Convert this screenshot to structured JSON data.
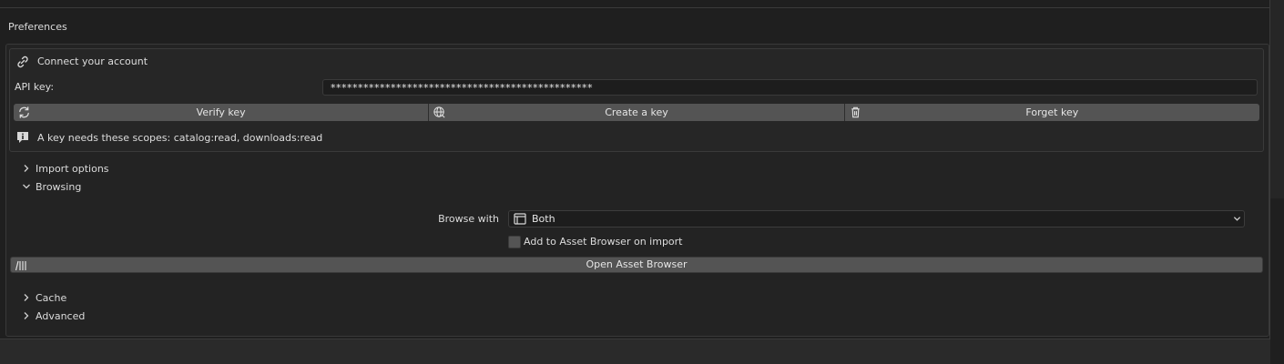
{
  "panel": {
    "title": "Preferences"
  },
  "account": {
    "header": "Connect your account",
    "api_key_label": "API key:",
    "api_key_value": "************************************************",
    "buttons": {
      "verify": "Verify key",
      "create": "Create a key",
      "forget": "Forget key"
    },
    "info": "A key needs these scopes: catalog:read, downloads:read"
  },
  "sections": {
    "import_options": "Import options",
    "browsing": "Browsing",
    "cache": "Cache",
    "advanced": "Advanced"
  },
  "browsing": {
    "browse_with_label": "Browse with",
    "browse_with_value": "Both",
    "add_to_browser_label": "Add to Asset Browser on import",
    "add_to_browser_checked": false,
    "open_browser_button": "Open Asset Browser"
  },
  "icons": {
    "header": "link-icon",
    "verify": "refresh-icon",
    "create": "globe-icon",
    "forget": "trash-icon",
    "info": "info-icon",
    "dropdown": "window-icon",
    "open_browser": "asset-library-icon"
  }
}
